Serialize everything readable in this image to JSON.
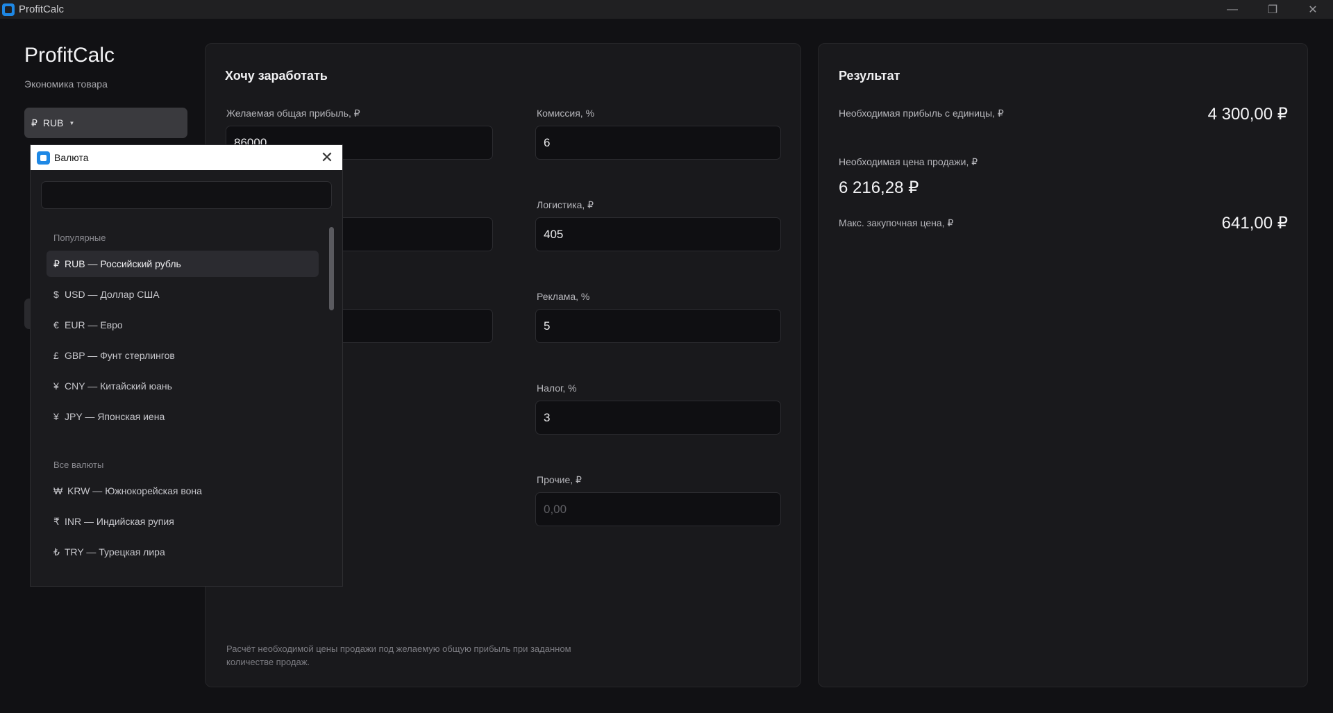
{
  "window": {
    "title": "ProfitCalc",
    "controls": [
      "—",
      "❐",
      "✕"
    ]
  },
  "sidebar": {
    "brand": "ProfitCalc",
    "subtitle": "Экономика товара",
    "currency_button": {
      "symbol": "₽",
      "code": "RUB"
    }
  },
  "form": {
    "title": "Хочу заработать",
    "fields": [
      {
        "label": "Желаемая общая прибыль, ₽",
        "value": "86000",
        "placeholder": ""
      },
      {
        "label": "Комиссия, %",
        "value": "6",
        "placeholder": ""
      },
      {
        "label": "",
        "value": "",
        "placeholder": ""
      },
      {
        "label": "Логистика, ₽",
        "value": "405",
        "placeholder": ""
      },
      {
        "label": "",
        "value": "",
        "placeholder": ""
      },
      {
        "label": "Реклама, %",
        "value": "5",
        "placeholder": ""
      },
      {
        "label": "Налог, %",
        "value": "3",
        "placeholder": ""
      },
      {
        "label": "Прочие, ₽",
        "value": "",
        "placeholder": "0,00"
      }
    ],
    "footnote": "Расчёт необходимой цены продажи под желаемую общую прибыль при заданном количестве продаж."
  },
  "result": {
    "title": "Результат",
    "rows": [
      {
        "label": "Необходимая прибыль с единицы, ₽",
        "value": "4 300,00 ₽"
      },
      {
        "label": "Необходимая цена продажи, ₽",
        "value": "6 216,28 ₽"
      },
      {
        "label": "Макс. закупочная цена, ₽",
        "value": "641,00 ₽"
      }
    ]
  },
  "dialog": {
    "title": "Валюта",
    "search_value": "",
    "popular_label": "Популярные",
    "all_label": "Все валюты",
    "popular": [
      {
        "symbol": "₽",
        "text": "RUB — Российский рубль",
        "selected": true
      },
      {
        "symbol": "$",
        "text": "USD — Доллар США",
        "selected": false
      },
      {
        "symbol": "€",
        "text": "EUR — Евро",
        "selected": false
      },
      {
        "symbol": "£",
        "text": "GBP — Фунт стерлингов",
        "selected": false
      },
      {
        "symbol": "¥",
        "text": "CNY — Китайский юань",
        "selected": false
      },
      {
        "symbol": "¥",
        "text": "JPY — Японская иена",
        "selected": false
      }
    ],
    "all": [
      {
        "symbol": "₩",
        "text": "KRW — Южнокорейская вона"
      },
      {
        "symbol": "₹",
        "text": "INR — Индийская рупия"
      },
      {
        "symbol": "₺",
        "text": "TRY — Турецкая лира"
      }
    ]
  },
  "colors": {
    "accent": "#1e88e5",
    "background": "#111114",
    "panel": "#19191c"
  }
}
